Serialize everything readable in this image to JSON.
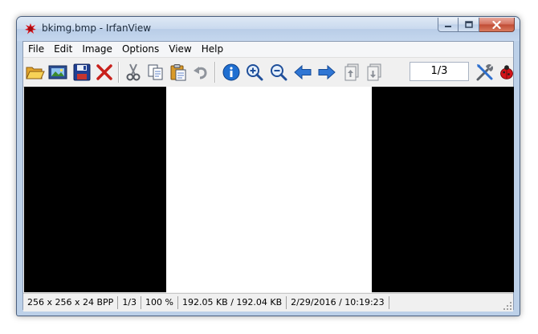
{
  "window": {
    "title": "bkimg.bmp - IrfanView"
  },
  "menu": {
    "items": [
      "File",
      "Edit",
      "Image",
      "Options",
      "View",
      "Help"
    ]
  },
  "toolbar": {
    "page_indicator": "1/3",
    "buttons": [
      "open-folder-icon",
      "slideshow-icon",
      "save-icon",
      "delete-icon",
      "cut-icon",
      "copy-icon",
      "paste-icon",
      "undo-icon",
      "info-icon",
      "zoom-in-icon",
      "zoom-out-icon",
      "previous-arrow-icon",
      "next-arrow-icon",
      "first-page-icon",
      "last-page-icon",
      "properties-tools-icon",
      "ladybug-icon"
    ]
  },
  "status": {
    "dimensions": "256 x 256 x 24 BPP",
    "page": "1/3",
    "zoom": "100 %",
    "file_size": "192.05 KB / 192.04 KB",
    "datetime": "2/29/2016 / 10:19:23"
  },
  "colors": {
    "viewport_background": "#000000",
    "image": "#ffffff",
    "window_frame": "#bcd0e8"
  }
}
